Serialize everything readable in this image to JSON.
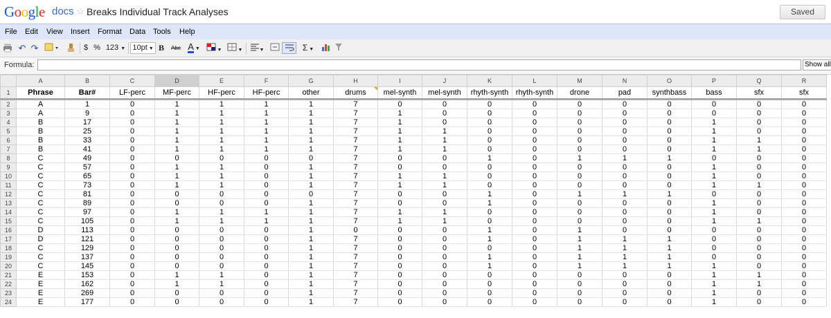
{
  "app": {
    "logo_text": "Google",
    "product": "docs",
    "doc_title": "Breaks Individual Track Analyses",
    "saved_label": "Saved"
  },
  "menu": [
    "File",
    "Edit",
    "View",
    "Insert",
    "Format",
    "Data",
    "Tools",
    "Help"
  ],
  "toolbar": {
    "currency": "$",
    "percent": "%",
    "number_format": "123",
    "font_size": "10pt",
    "bold": "B",
    "strike": "Abc",
    "text_color": "A",
    "sum": "Σ"
  },
  "formula": {
    "label": "Formula:",
    "value": "",
    "show_all_label": "Show all f"
  },
  "columns": [
    "A",
    "B",
    "C",
    "D",
    "E",
    "F",
    "G",
    "H",
    "I",
    "J",
    "K",
    "L",
    "M",
    "N",
    "O",
    "P",
    "Q",
    "R"
  ],
  "selected_column": "D",
  "headers": [
    "Phrase",
    "Bar#",
    "LF-perc",
    "MF-perc",
    "HF-perc",
    "HF-perc",
    "other",
    "drums",
    "mel-synth",
    "mel-synth",
    "rhyth-synth",
    "rhyth-synth",
    "drone",
    "pad",
    "synthbass",
    "bass",
    "sfx",
    "sfx"
  ],
  "rows": [
    [
      "A",
      "1",
      "0",
      "1",
      "1",
      "1",
      "1",
      "7",
      "0",
      "0",
      "0",
      "0",
      "0",
      "0",
      "0",
      "0",
      "0",
      "0"
    ],
    [
      "A",
      "9",
      "0",
      "1",
      "1",
      "1",
      "1",
      "7",
      "1",
      "0",
      "0",
      "0",
      "0",
      "0",
      "0",
      "0",
      "0",
      "0"
    ],
    [
      "B",
      "17",
      "0",
      "1",
      "1",
      "1",
      "1",
      "7",
      "1",
      "0",
      "0",
      "0",
      "0",
      "0",
      "0",
      "1",
      "0",
      "0"
    ],
    [
      "B",
      "25",
      "0",
      "1",
      "1",
      "1",
      "1",
      "7",
      "1",
      "1",
      "0",
      "0",
      "0",
      "0",
      "0",
      "1",
      "0",
      "0"
    ],
    [
      "B",
      "33",
      "0",
      "1",
      "1",
      "1",
      "1",
      "7",
      "1",
      "1",
      "0",
      "0",
      "0",
      "0",
      "0",
      "1",
      "1",
      "0"
    ],
    [
      "B",
      "41",
      "0",
      "1",
      "1",
      "1",
      "1",
      "7",
      "1",
      "1",
      "0",
      "0",
      "0",
      "0",
      "0",
      "1",
      "1",
      "0"
    ],
    [
      "C",
      "49",
      "0",
      "0",
      "0",
      "0",
      "0",
      "7",
      "0",
      "0",
      "1",
      "0",
      "1",
      "1",
      "1",
      "0",
      "0",
      "0"
    ],
    [
      "C",
      "57",
      "0",
      "1",
      "1",
      "0",
      "1",
      "7",
      "0",
      "0",
      "0",
      "0",
      "0",
      "0",
      "0",
      "1",
      "0",
      "0"
    ],
    [
      "C",
      "65",
      "0",
      "1",
      "1",
      "0",
      "1",
      "7",
      "1",
      "1",
      "0",
      "0",
      "0",
      "0",
      "0",
      "1",
      "0",
      "0"
    ],
    [
      "C",
      "73",
      "0",
      "1",
      "1",
      "0",
      "1",
      "7",
      "1",
      "1",
      "0",
      "0",
      "0",
      "0",
      "0",
      "1",
      "1",
      "0"
    ],
    [
      "C",
      "81",
      "0",
      "0",
      "0",
      "0",
      "0",
      "7",
      "0",
      "0",
      "1",
      "0",
      "1",
      "1",
      "1",
      "0",
      "0",
      "0"
    ],
    [
      "C",
      "89",
      "0",
      "0",
      "0",
      "0",
      "1",
      "7",
      "0",
      "0",
      "1",
      "0",
      "0",
      "0",
      "0",
      "1",
      "0",
      "0"
    ],
    [
      "C",
      "97",
      "0",
      "1",
      "1",
      "1",
      "1",
      "7",
      "1",
      "1",
      "0",
      "0",
      "0",
      "0",
      "0",
      "1",
      "0",
      "0"
    ],
    [
      "C",
      "105",
      "0",
      "1",
      "1",
      "1",
      "1",
      "7",
      "1",
      "1",
      "0",
      "0",
      "0",
      "0",
      "0",
      "1",
      "1",
      "0"
    ],
    [
      "D",
      "113",
      "0",
      "0",
      "0",
      "0",
      "1",
      "0",
      "0",
      "0",
      "1",
      "0",
      "1",
      "0",
      "0",
      "0",
      "0",
      "0"
    ],
    [
      "D",
      "121",
      "0",
      "0",
      "0",
      "0",
      "1",
      "7",
      "0",
      "0",
      "1",
      "0",
      "1",
      "1",
      "1",
      "0",
      "0",
      "0"
    ],
    [
      "C",
      "129",
      "0",
      "0",
      "0",
      "0",
      "1",
      "7",
      "0",
      "0",
      "0",
      "0",
      "1",
      "1",
      "1",
      "0",
      "0",
      "0"
    ],
    [
      "C",
      "137",
      "0",
      "0",
      "0",
      "0",
      "1",
      "7",
      "0",
      "0",
      "1",
      "0",
      "1",
      "1",
      "1",
      "0",
      "0",
      "0"
    ],
    [
      "C",
      "145",
      "0",
      "0",
      "0",
      "0",
      "1",
      "7",
      "0",
      "0",
      "1",
      "0",
      "1",
      "1",
      "1",
      "1",
      "0",
      "0"
    ],
    [
      "E",
      "153",
      "0",
      "1",
      "1",
      "0",
      "1",
      "7",
      "0",
      "0",
      "0",
      "0",
      "0",
      "0",
      "0",
      "1",
      "1",
      "0"
    ],
    [
      "E",
      "162",
      "0",
      "1",
      "1",
      "0",
      "1",
      "7",
      "0",
      "0",
      "0",
      "0",
      "0",
      "0",
      "0",
      "1",
      "1",
      "0"
    ],
    [
      "E",
      "269",
      "0",
      "0",
      "0",
      "0",
      "1",
      "7",
      "0",
      "0",
      "0",
      "0",
      "0",
      "0",
      "0",
      "1",
      "0",
      "0"
    ],
    [
      "E",
      "177",
      "0",
      "0",
      "0",
      "0",
      "1",
      "7",
      "0",
      "0",
      "0",
      "0",
      "0",
      "0",
      "0",
      "1",
      "0",
      "0"
    ]
  ]
}
